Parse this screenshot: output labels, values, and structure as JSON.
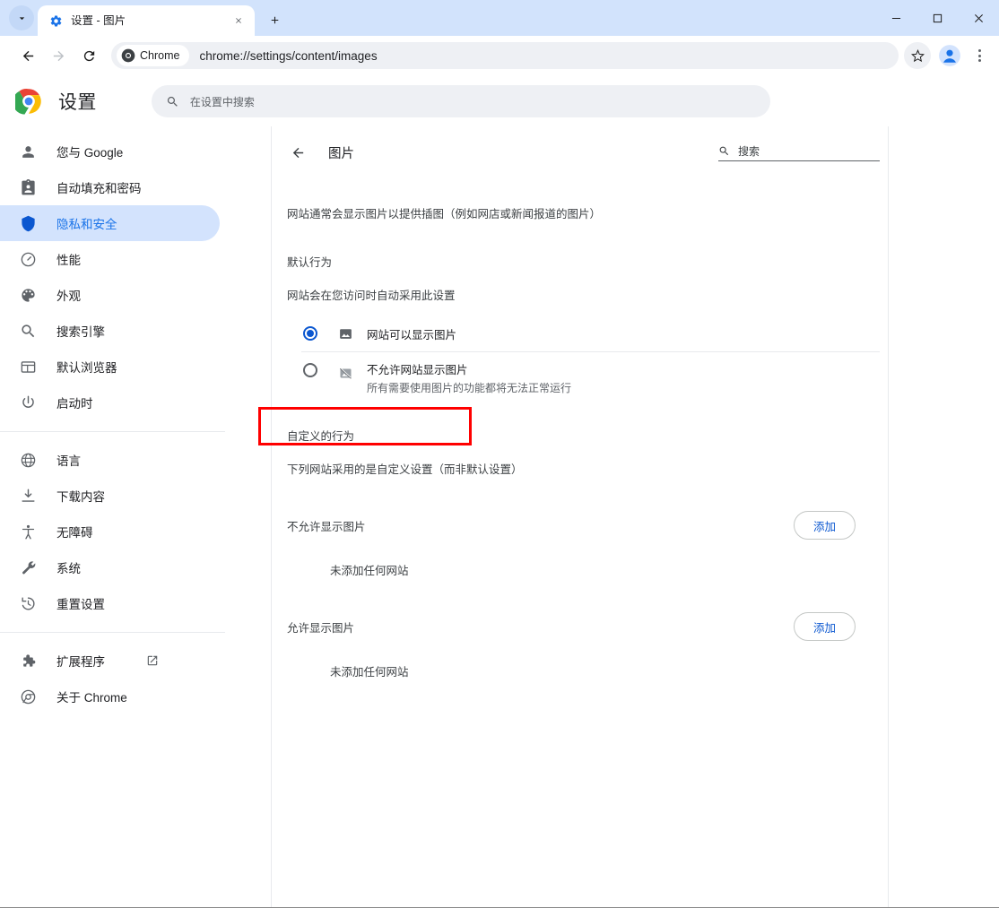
{
  "window": {
    "tab": {
      "title": "设置 - 图片",
      "favicon": "gear-icon",
      "close": "×"
    },
    "new_tab_label": "+",
    "controls": {
      "minimize": "—",
      "maximize": "□",
      "close": "✕"
    }
  },
  "toolbar": {
    "back": "←",
    "forward": "→",
    "reload": "⟳",
    "chip_label": "Chrome",
    "url": "chrome://settings/content/images",
    "bookmark_icon": "star-icon",
    "profile_icon": "profile-avatar-icon",
    "menu_icon": "three-dot-menu-icon"
  },
  "settings": {
    "brand_title": "设置",
    "search": {
      "placeholder": "在设置中搜索",
      "icon": "search-icon"
    }
  },
  "sidebar": {
    "items": [
      {
        "label": "您与 Google",
        "icon": "person-icon",
        "active": false
      },
      {
        "label": "自动填充和密码",
        "icon": "clipboard-icon",
        "active": false
      },
      {
        "label": "隐私和安全",
        "icon": "shield-icon",
        "active": true
      },
      {
        "label": "性能",
        "icon": "speedometer-icon",
        "active": false
      },
      {
        "label": "外观",
        "icon": "palette-icon",
        "active": false
      },
      {
        "label": "搜索引擎",
        "icon": "search-icon",
        "active": false
      },
      {
        "label": "默认浏览器",
        "icon": "browser-window-icon",
        "active": false
      },
      {
        "label": "启动时",
        "icon": "power-icon",
        "active": false
      }
    ],
    "items2": [
      {
        "label": "语言",
        "icon": "globe-icon"
      },
      {
        "label": "下载内容",
        "icon": "download-icon"
      },
      {
        "label": "无障碍",
        "icon": "accessibility-icon"
      },
      {
        "label": "系统",
        "icon": "wrench-icon"
      },
      {
        "label": "重置设置",
        "icon": "history-restore-icon"
      }
    ],
    "items3": [
      {
        "label": "扩展程序",
        "icon": "puzzle-icon",
        "external": true
      },
      {
        "label": "关于 Chrome",
        "icon": "chrome-logo-icon",
        "external": false
      }
    ]
  },
  "content": {
    "back_icon": "arrow-left-icon",
    "title": "图片",
    "search": {
      "placeholder": "搜索",
      "icon": "search-icon"
    },
    "description": "网站通常会显示图片以提供插图（例如网店或新闻报道的图片）",
    "default_behavior_label": "默认行为",
    "default_behavior_sub": "网站会在您访问时自动采用此设置",
    "options": [
      {
        "title": "网站可以显示图片",
        "subtitle": "",
        "icon": "image-icon",
        "selected": true,
        "highlighted": true
      },
      {
        "title": "不允许网站显示图片",
        "subtitle": "所有需要使用图片的功能都将无法正常运行",
        "icon": "image-blocked-icon",
        "selected": false,
        "highlighted": false
      }
    ],
    "custom_behavior_label": "自定义的行为",
    "custom_behavior_sub": "下列网站采用的是自定义设置（而非默认设置）",
    "permission_blocks": [
      {
        "label": "不允许显示图片",
        "add_label": "添加",
        "empty": "未添加任何网站"
      },
      {
        "label": "允许显示图片",
        "add_label": "添加",
        "empty": "未添加任何网站"
      }
    ]
  },
  "colors": {
    "tabstrip": "#d2e3fc",
    "accent": "#0b57d0",
    "active_nav_bg": "#d3e3fd",
    "highlight_red": "#ff0000",
    "omnibox_bg": "#eef0f4"
  }
}
